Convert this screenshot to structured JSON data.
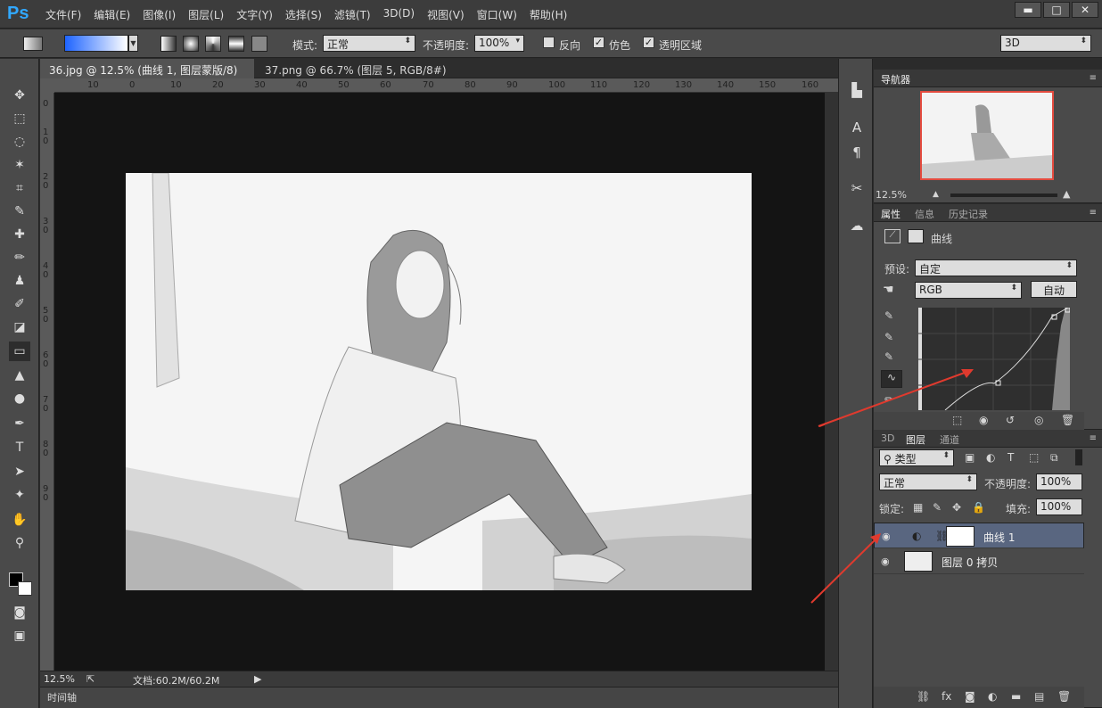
{
  "app": {
    "logo": "Ps",
    "menu": [
      "文件(F)",
      "编辑(E)",
      "图像(I)",
      "图层(L)",
      "文字(Y)",
      "选择(S)",
      "滤镜(T)",
      "3D(D)",
      "视图(V)",
      "窗口(W)",
      "帮助(H)"
    ],
    "win": [
      "▬",
      "□",
      "✕"
    ]
  },
  "options": {
    "mode_label": "模式:",
    "mode_value": "正常",
    "opacity_label": "不透明度:",
    "opacity_value": "100%",
    "reverse_label": "反向",
    "dither_label": "仿色",
    "transparency_label": "透明区域",
    "workspace": "3D"
  },
  "tabs": [
    {
      "label": "36.jpg @ 12.5% (曲线 1, 图层蒙版/8) *",
      "close": "×"
    },
    {
      "label": "37.png @ 66.7% (图层 5, RGB/8#) *",
      "close": "×"
    }
  ],
  "ruler": {
    "h": [
      "10",
      "0",
      "10",
      "20",
      "30",
      "40",
      "50",
      "60",
      "70",
      "80",
      "90",
      "100",
      "110",
      "120",
      "130",
      "140",
      "150",
      "160"
    ],
    "v": [
      "0",
      "1",
      "0",
      "2",
      "0",
      "3",
      "0",
      "4",
      "0",
      "5",
      "0",
      "6",
      "0",
      "7",
      "0",
      "8",
      "0",
      "9",
      "0"
    ]
  },
  "status": {
    "zoom": "12.5%",
    "doc": "文档:60.2M/60.2M",
    "timeline": "时间轴"
  },
  "navigator": {
    "title": "导航器",
    "zoom": "12.5%"
  },
  "properties": {
    "tabs": [
      "属性",
      "信息",
      "历史记录"
    ],
    "title": "曲线",
    "preset_label": "预设:",
    "preset_value": "自定",
    "channel": "RGB",
    "auto": "自动"
  },
  "layers": {
    "tabs": [
      "3D",
      "图层",
      "通道"
    ],
    "kind": "类型",
    "blend": "正常",
    "opacity_label": "不透明度:",
    "opacity_value": "100%",
    "lock_label": "锁定:",
    "fill_label": "填充:",
    "fill_value": "100%",
    "items": [
      {
        "name": "曲线 1"
      },
      {
        "name": "图层 0 拷贝"
      }
    ]
  }
}
